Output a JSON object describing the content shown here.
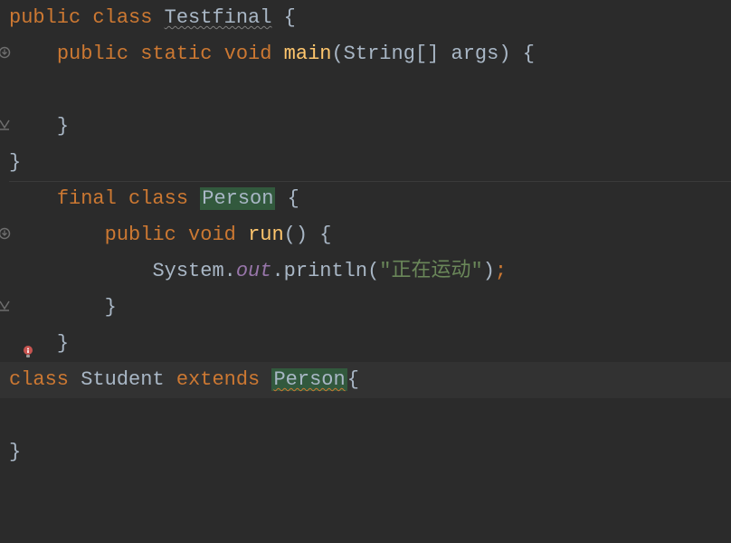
{
  "code": {
    "lines": [
      {
        "tokens": [
          {
            "t": "public ",
            "cls": "kw"
          },
          {
            "t": "class ",
            "cls": "kw"
          },
          {
            "t": "Testfinal",
            "cls": "classname warn-underline"
          },
          {
            "t": " {",
            "cls": "brace"
          }
        ]
      },
      {
        "indent": "    ",
        "tokens": [
          {
            "t": "public ",
            "cls": "kw"
          },
          {
            "t": "static ",
            "cls": "kw"
          },
          {
            "t": "void ",
            "cls": "kw"
          },
          {
            "t": "main",
            "cls": "methoddef"
          },
          {
            "t": "(String[] args) {",
            "cls": "paren"
          }
        ],
        "gutter": "override"
      },
      {
        "indent": "",
        "tokens": []
      },
      {
        "indent": "    ",
        "tokens": [
          {
            "t": "}",
            "cls": "brace"
          }
        ],
        "gutter": "close"
      },
      {
        "indent": "",
        "tokens": [
          {
            "t": "}",
            "cls": "brace"
          }
        ],
        "sep_after": true
      },
      {
        "indent": "    ",
        "tokens": [
          {
            "t": "final ",
            "cls": "kw"
          },
          {
            "t": "class ",
            "cls": "kw"
          },
          {
            "t": "Person",
            "cls": "classname highlight-box"
          },
          {
            "t": " {",
            "cls": "brace"
          }
        ]
      },
      {
        "indent": "        ",
        "tokens": [
          {
            "t": "public ",
            "cls": "kw"
          },
          {
            "t": "void ",
            "cls": "kw"
          },
          {
            "t": "run",
            "cls": "methoddef"
          },
          {
            "t": "() {",
            "cls": "paren"
          }
        ],
        "gutter": "override"
      },
      {
        "indent": "            ",
        "tokens": [
          {
            "t": "System",
            "cls": "classname"
          },
          {
            "t": ".",
            "cls": "dot"
          },
          {
            "t": "out",
            "cls": "static-field"
          },
          {
            "t": ".",
            "cls": "dot"
          },
          {
            "t": "println(",
            "cls": "paren"
          },
          {
            "t": "\"正在运动\"",
            "cls": "string"
          },
          {
            "t": ")",
            "cls": "paren"
          },
          {
            "t": ";",
            "cls": "semicolon"
          }
        ]
      },
      {
        "indent": "        ",
        "tokens": [
          {
            "t": "}",
            "cls": "brace"
          }
        ],
        "gutter": "close"
      },
      {
        "indent": "    ",
        "tokens": [
          {
            "t": "}",
            "cls": "brace"
          }
        ],
        "bulb": true,
        "sep_after": true
      },
      {
        "indent": "",
        "highlighted": true,
        "tokens": [
          {
            "t": "class ",
            "cls": "kw"
          },
          {
            "t": "Student",
            "cls": "classname"
          },
          {
            "t": " ",
            "cls": ""
          },
          {
            "t": "extends ",
            "cls": "kw"
          },
          {
            "t": "Person",
            "cls": "classname highlight-box err-underline"
          },
          {
            "t": "{",
            "cls": "brace"
          }
        ]
      },
      {
        "indent": "",
        "tokens": []
      },
      {
        "indent": "",
        "tokens": [
          {
            "t": "}",
            "cls": "brace"
          }
        ]
      },
      {
        "indent": "",
        "tokens": []
      },
      {
        "indent": "",
        "tokens": []
      }
    ]
  },
  "icons": {
    "override": "override-marker-icon",
    "close": "collapse-marker-icon",
    "bulb": "error-bulb-icon"
  }
}
